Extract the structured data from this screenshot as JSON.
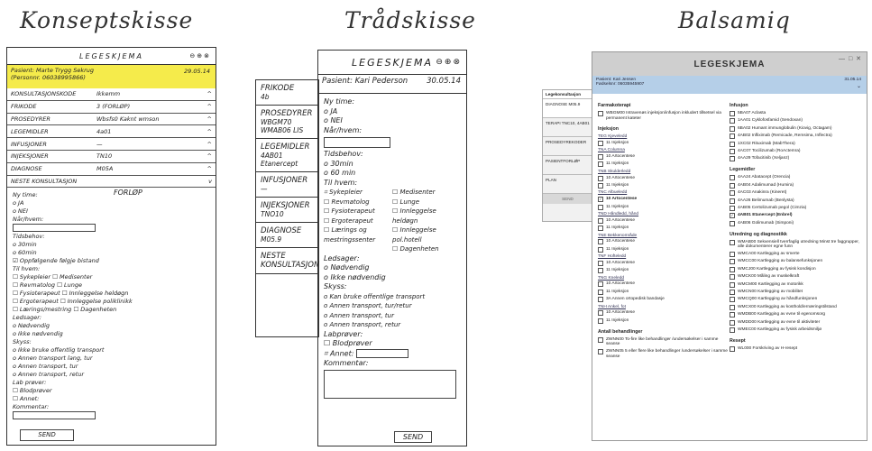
{
  "titles": {
    "concept": "Konseptskisse",
    "wire": "Trådskisse",
    "balsamiq": "Balsamiq"
  },
  "sketch1": {
    "header": "LEGESKJEMA",
    "icons": "⊖⊕⊗",
    "patient_line1": "Pasient: Marte Trygg Sekrug",
    "patient_line2": "(Personnr. 06038995866)",
    "date": "29.05.14",
    "rows": [
      {
        "k": "KONSULTASJONSKODE",
        "v": "Ikkemm",
        "c": "^"
      },
      {
        "k": "FRIKODE",
        "v": "3 (FORLØP)",
        "c": "^"
      },
      {
        "k": "PROSEDYRER",
        "v": "Wbsfs0 Kaknt wmson",
        "c": "^"
      },
      {
        "k": "LEGEMIDLER",
        "v": "4a01",
        "c": "^"
      },
      {
        "k": "INFUSJONER",
        "v": "—",
        "c": "^"
      },
      {
        "k": "INJEKSJONER",
        "v": "TN10",
        "c": "^"
      },
      {
        "k": "DIAGNOSE",
        "v": "M05A",
        "c": "^"
      },
      {
        "k": "NESTE KONSULTASJON",
        "v": "",
        "c": "v"
      }
    ],
    "forlop": "FORLØP",
    "body": [
      "Ny time:",
      "o JA",
      "o NEI",
      "Når/hvem:",
      "Tidsbehov:",
      "o 30min",
      "o 60min",
      "☑ Oppfølgende følgje bistand",
      "Til hvem:",
      "☐ Sykepleier   ☐ Medisenter",
      "☐ Revmatolog   ☐ Lunge",
      "☐ Fysioterapeut   ☐ Innleggelse heldøgn",
      "☐ Ergoterapeut   ☐ Innleggelse poliklinikk",
      "☐ Lærings/mestring  ☐ Dagenheten",
      "Ledsager:",
      "o Nødvendig",
      "o Ikke nødvendig",
      "Skyss:",
      "o Ikke bruke offentlig transport",
      "o Annen transport lang, tur",
      "o Annen transport, tur",
      "o Annen transport, retur",
      "Lab prøver:",
      "☐ Blodprøver",
      "☐ Annet:",
      "Kommentar:"
    ],
    "send": "SEND"
  },
  "sketch2": {
    "header": "LEGESKJEMA",
    "icons": "⊖⊕⊗",
    "patient": "Pasient: Kari Pederson",
    "date": "30.05.14",
    "side": [
      {
        "k": "FRIKODE",
        "v": "4b"
      },
      {
        "k": "PROSEDYRER",
        "v": "WBGM70 WMAB06 LIS"
      },
      {
        "k": "LEGEMIDLER",
        "v": "4AB01 Etanercept"
      },
      {
        "k": "INFUSJONER",
        "v": "—"
      },
      {
        "k": "INJEKSJONER",
        "v": "TNO10"
      },
      {
        "k": "DIAGNOSE",
        "v": "M05.9"
      },
      {
        "k": "NESTE KONSULTASJON",
        "v": ""
      }
    ],
    "ny_time": "Ny time:",
    "ja": "o JA",
    "nei": "o NEI",
    "naar": "Når/hvem:",
    "tidsbehov": "Tidsbehov:",
    "t30": "o 30min",
    "t60": "o 60 min",
    "til_hvem": "Til hvem:",
    "left_opts": [
      "⌗ Sykepleier",
      "☐ Revmatolog",
      "☐ Fysioterapeut",
      "☐ Ergoterapeut",
      "☐ Lærings og mestringssenter"
    ],
    "right_opts": [
      "☐ Medisenter",
      "☐ Lunge",
      "☐ Innleggelse heldøgn",
      "☐ Innleggelse pol.hotell",
      "☐ Dagenheten"
    ],
    "ledsager": "Ledsager:",
    "l1": "o Nødvendig",
    "l2": "o Ikke nødvendig",
    "skyss": "Skyss:",
    "skyss_opts": [
      "o Kan bruke offentlige transport",
      "o Annen transport, tur/retur",
      "o Annen transport, tur",
      "o Annen transport, retur"
    ],
    "lab": "Labprøver:",
    "lab1": "☐ Blodprøver",
    "lab2": "⌗ Annet:",
    "kommentar": "Kommentar:",
    "send": "SEND"
  },
  "balsamiq": {
    "header": "LEGESKJEMA",
    "controls": "— □ ✕",
    "patient": "Pasient: Kari Jensen",
    "personnr": "Fødselsnr: 06035945907",
    "date": "31.05.14",
    "side_label": "Legekonsultasjon",
    "side": [
      "DIAGNOSE M05.9",
      "TERAPI TNC10, 4AB01",
      "PROSEDYREKODER",
      "PASIENTFORLØP",
      "PLAN"
    ],
    "side_send": "SEND",
    "left": [
      {
        "sec": "Farmakoterapi"
      },
      {
        "cb": "☐",
        "t": "WBGM00 Intravenøs injeksjon/infusjon inkludert tillsetsel via permanent kateter"
      },
      {
        "sec": "Injeksjon"
      },
      {
        "link": "TEG Kjeveledd"
      },
      {
        "cb": "☐",
        "t": "11 Injeksjon"
      },
      {
        "link": "TNA Columna"
      },
      {
        "cb": "☐",
        "t": "10 Artocentese"
      },
      {
        "cb": "☐",
        "t": "11 Injeksjon"
      },
      {
        "link": "TNB Skulderledd"
      },
      {
        "cb": "☐",
        "t": "10 Artocentese"
      },
      {
        "cb": "☐",
        "t": "11 Injeksjon"
      },
      {
        "link": "TNC Albueledd"
      },
      {
        "cb": "☑",
        "t": "10 Artocentese",
        "b": true
      },
      {
        "cb": "☐",
        "t": "11 Injeksjon"
      },
      {
        "link": "TND Håndledd, hånd"
      },
      {
        "cb": "☐",
        "t": "10 Artocentese"
      },
      {
        "cb": "☐",
        "t": "11 Injeksjon"
      },
      {
        "link": "TNE Bekkenområde"
      },
      {
        "cb": "☐",
        "t": "10 Artocentese"
      },
      {
        "cb": "☐",
        "t": "11 Injeksjon"
      },
      {
        "link": "TNF Hofteledd"
      },
      {
        "cb": "☐",
        "t": "10 Artocentese"
      },
      {
        "cb": "☐",
        "t": "11 Injeksjon"
      },
      {
        "link": "TNG Kneledd"
      },
      {
        "cb": "☐",
        "t": "10 Artocentese"
      },
      {
        "cb": "☐",
        "t": "11 Injeksjon"
      },
      {
        "cb": "☐",
        "t": "3A Annen ortopedisk bandasje"
      },
      {
        "link": "TNH Ankel, fot"
      },
      {
        "cb": "☐",
        "t": "10 Artocentese"
      },
      {
        "cb": "☐",
        "t": "11 Injeksjon"
      },
      {
        "sec": "Antall behandlinger"
      },
      {
        "cb": "☐",
        "t": "ZWNN00 To-fire like behandlinger /undersøkelser i samme seanse"
      },
      {
        "cb": "☐",
        "t": "ZWNN05 5 eller flere like behandlinger /undersøkelser i samme seanse"
      }
    ],
    "right": [
      {
        "sec": "Infusjon"
      },
      {
        "cb": "☐",
        "t": "5BA07 Aclasta"
      },
      {
        "cb": "☐",
        "t": "1AA01 Cyklofosfamid (Sendoxan)"
      },
      {
        "cb": "☐",
        "t": "6BA02 Humant immunglobulin (Kiovig, Octagam)"
      },
      {
        "cb": "☐",
        "t": "4AB02 Infliximab (Remicade, Remsima, Inflectra)"
      },
      {
        "cb": "☐",
        "t": "1XC02 Rituximab (MabThera)"
      },
      {
        "cb": "☐",
        "t": "4AC07 Tocilizumab (RoActemra)"
      },
      {
        "cb": "☐",
        "t": "4AA29 Tofacitinib (Xeljanz)"
      },
      {
        "sec": "Legemidler"
      },
      {
        "cb": "☐",
        "t": "4AA24 Abatacept (Orencia)"
      },
      {
        "cb": "☐",
        "t": "4AB04 Adalimumad (Humira)"
      },
      {
        "cb": "☐",
        "t": "4AC03 Anakinra (Kineret)"
      },
      {
        "cb": "☐",
        "t": "4AA26 Belimumab (Benlysta)"
      },
      {
        "cb": "☐",
        "t": "4AB05 Certolizumab pegol (Cimzia)"
      },
      {
        "cb": "☑",
        "t": "4AB01 Etanercept (Enbrel)",
        "b": true
      },
      {
        "cb": "☐",
        "t": "4AB06 Golimumab (Simponi)"
      },
      {
        "sec": "Utredning og diagnostikk"
      },
      {
        "cb": "☐",
        "t": "WMAB00 Sekvensiell tverrfaglig utredning Minst tre faggrupper, alle dokumenterer egne funn"
      },
      {
        "cb": "☐",
        "t": "WMCA00 Kartlegging av smerte"
      },
      {
        "cb": "☐",
        "t": "WMCC00 Kartlegging av balansefunksjonen"
      },
      {
        "cb": "☐",
        "t": "WMCJ00 Kartlegging av fysisk kondisjon"
      },
      {
        "cb": "☐",
        "t": "WMCK00 Måling av muskelkraft"
      },
      {
        "cb": "☐",
        "t": "WMCM00 Kartlegging av motorikk"
      },
      {
        "cb": "☐",
        "t": "WMCN00 Kartlegging av mobilitet"
      },
      {
        "cb": "☐",
        "t": "WMCQ00 Kartlegging av håndfunksjonen"
      },
      {
        "cb": "☐",
        "t": "WMCX00 Kartlegging av kosthold/ernæringstilstand"
      },
      {
        "cb": "☐",
        "t": "WMDB00 Kartlegging av evne til egenomsorg"
      },
      {
        "cb": "☐",
        "t": "WMDD00 Kartlegging av evne til aktiviteter"
      },
      {
        "cb": "☐",
        "t": "WMEC00 Kartlegging av fysisk arbeidsmiljø"
      },
      {
        "sec": "Resept"
      },
      {
        "cb": "☐",
        "t": "WL000 Forskriving av H-resept"
      }
    ]
  }
}
